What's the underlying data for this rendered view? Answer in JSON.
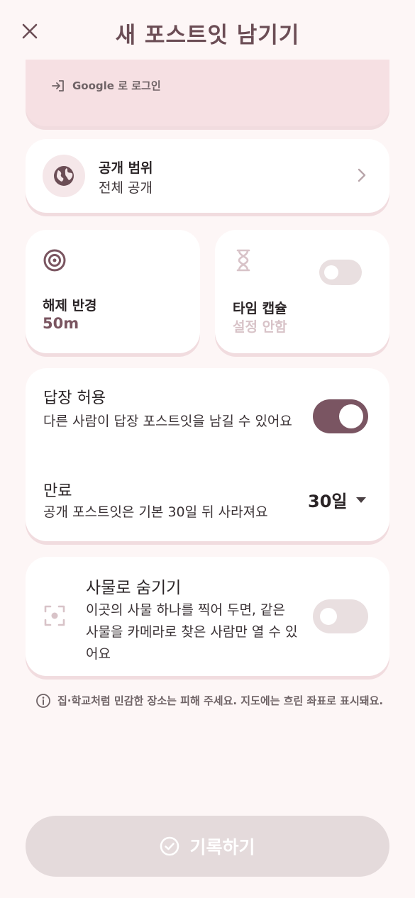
{
  "header": {
    "title": "새 포스트잇 남기기"
  },
  "login": {
    "label": "Google 로 로그인"
  },
  "visibility": {
    "label": "공개 범위",
    "value": "전체 공개"
  },
  "radius": {
    "label": "해제 반경",
    "value": "50m"
  },
  "time_capsule": {
    "label": "타임 캡슐",
    "value": "설정 안함",
    "enabled": false
  },
  "reply": {
    "title": "답장 허용",
    "description": "다른 사람이 답장 포스트잇을 남길 수 있어요",
    "enabled": true
  },
  "expiry": {
    "title": "만료",
    "description": "공개 포스트잇은 기본 30일 뒤 사라져요",
    "selected": "30일"
  },
  "object_hide": {
    "title": "사물로 숨기기",
    "description": "이곳의 사물 하나를 찍어 두면, 같은 사물을 카메라로 찾은 사람만 열 수 있어요",
    "enabled": false
  },
  "notice": {
    "text": "집·학교처럼 민감한 장소는 피해 주세요. 지도에는 흐린 좌표로 표시돼요."
  },
  "submit": {
    "label": "기록하기"
  },
  "colors": {
    "background": "#fdf6f6",
    "accent": "#7a5562",
    "title": "#6b4d55",
    "login_card": "#f6e0e3",
    "toggle_off": "#e9dfe0",
    "button_disabled": "#e4dadb"
  }
}
